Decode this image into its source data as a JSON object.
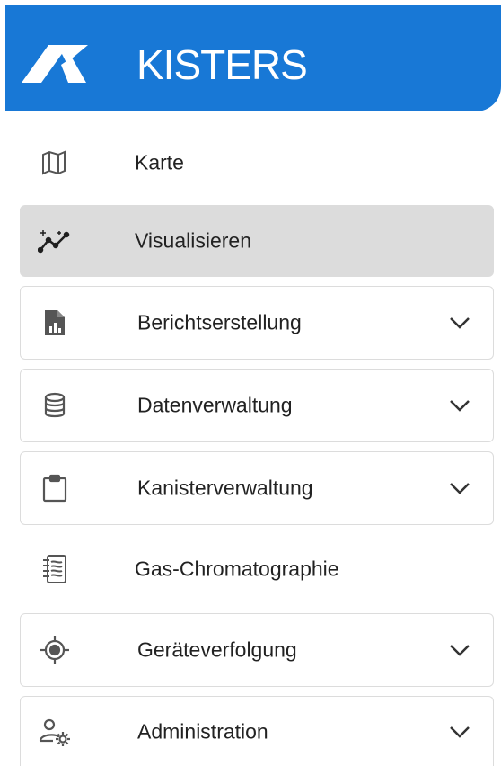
{
  "header": {
    "brand": "KISTERS",
    "background": "#1878d6"
  },
  "nav": [
    {
      "id": "karte",
      "label": "Karte",
      "icon": "map-icon",
      "expandable": false,
      "active": false
    },
    {
      "id": "visualisieren",
      "label": "Visualisieren",
      "icon": "sparkle-chart-icon",
      "expandable": false,
      "active": true
    },
    {
      "id": "berichtserstellung",
      "label": "Berichtserstellung",
      "icon": "report-icon",
      "expandable": true,
      "active": false
    },
    {
      "id": "datenverwaltung",
      "label": "Datenverwaltung",
      "icon": "database-icon",
      "expandable": true,
      "active": false
    },
    {
      "id": "kanisterverwaltung",
      "label": "Kanisterverwaltung",
      "icon": "clipboard-icon",
      "expandable": true,
      "active": false
    },
    {
      "id": "gas-chromatographie",
      "label": "Gas-Chromatographie",
      "icon": "notebook-icon",
      "expandable": false,
      "active": false
    },
    {
      "id": "geraeteverfolgung",
      "label": "Geräteverfolgung",
      "icon": "target-icon",
      "expandable": true,
      "active": false
    },
    {
      "id": "administration",
      "label": "Administration",
      "icon": "user-settings-icon",
      "expandable": true,
      "active": false
    }
  ]
}
